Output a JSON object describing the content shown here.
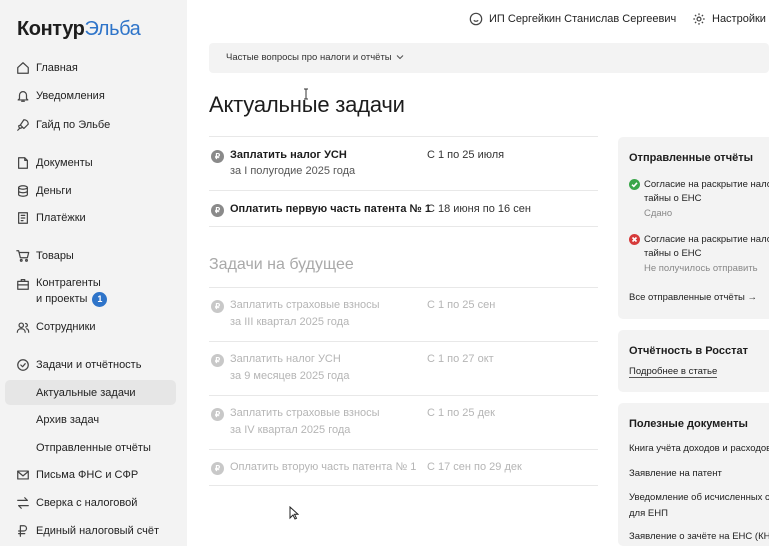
{
  "logo": {
    "part1": "Контур",
    "part2": "Эльба"
  },
  "sidebar": {
    "items": [
      {
        "label": "Главная"
      },
      {
        "label": "Уведомления"
      },
      {
        "label": "Гайд по Эльбе"
      },
      {
        "label": "Документы"
      },
      {
        "label": "Деньги"
      },
      {
        "label": "Платёжки"
      },
      {
        "label": "Товары"
      },
      {
        "label": "Контрагенты",
        "label2": "и проекты",
        "badge": "1"
      },
      {
        "label": "Сотрудники"
      },
      {
        "label": "Задачи и отчётность"
      },
      {
        "label": "Актуальные задачи"
      },
      {
        "label": "Архив задач"
      },
      {
        "label": "Отправленные отчёты"
      },
      {
        "label": "Письма ФНС и СФР"
      },
      {
        "label": "Сверка с налоговой"
      },
      {
        "label": "Единый налоговый счёт"
      }
    ]
  },
  "header": {
    "user": "ИП Сергейкин Станислав Сергеевич",
    "settings": "Настройки"
  },
  "faq": {
    "label": "Частые вопросы про налоги и отчёты"
  },
  "main": {
    "title": "Актуальные задачи",
    "future_title": "Задачи на будущее",
    "current_tasks": [
      {
        "name": "Заплатить налог УСН",
        "period": "за I полугодие 2025 года",
        "date": "С 1 по 25 июля"
      },
      {
        "name": "Оплатить первую часть патента № 1",
        "period": "",
        "date": "С 18 июня по 16 сен"
      }
    ],
    "future_tasks": [
      {
        "name": "Заплатить страховые взносы",
        "period": "за III квартал 2025 года",
        "date": "С 1 по 25 сен"
      },
      {
        "name": "Заплатить налог УСН",
        "period": "за 9 месяцев 2025 года",
        "date": "С 1 по 27 окт"
      },
      {
        "name": "Заплатить страховые взносы",
        "period": "за IV квартал 2025 года",
        "date": "С 1 по 25 дек"
      },
      {
        "name": "Оплатить вторую часть патента № 1",
        "period": "",
        "date": "С 17 сен по 29 дек"
      }
    ],
    "ruble_sign": "₽"
  },
  "panels": {
    "sent": {
      "title": "Отправленные отчёты",
      "reports": [
        {
          "line1": "Согласие на раскрытие нало",
          "line2": "тайны о ЕНС",
          "status": "Сдано"
        },
        {
          "line1": "Согласие на раскрытие нало",
          "line2": "тайны о ЕНС",
          "status": "Не получилось отправить"
        }
      ],
      "all_link": "Все отправленные отчёты →"
    },
    "rosstat": {
      "title": "Отчётность в Росстат",
      "link": "Подробнее в статье"
    },
    "docs": {
      "title": "Полезные документы",
      "items": [
        {
          "line1": "Книга учёта доходов и расходов",
          "line2": ""
        },
        {
          "line1": "Заявление на патент",
          "line2": ""
        },
        {
          "line1": "Уведомление об исчисленных су",
          "line2": "для ЕНП"
        },
        {
          "line1": "Заявление о зачёте на ЕНС (КНД",
          "line2": ""
        }
      ]
    }
  }
}
